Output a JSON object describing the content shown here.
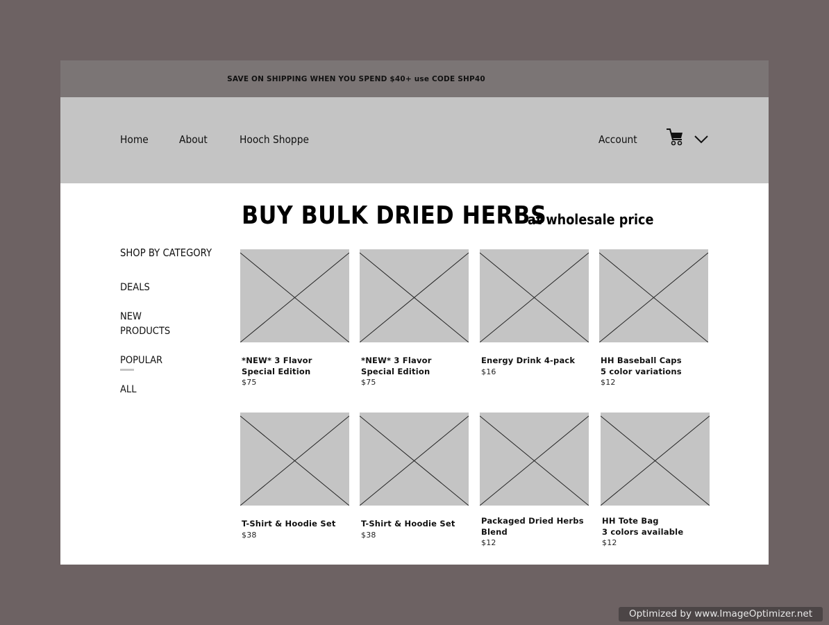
{
  "banner": {
    "text": "SAVE ON SHIPPING WHEN YOU SPEND $40+ use CODE SHP40"
  },
  "nav": {
    "links": [
      "Home",
      "About",
      "Hooch Shoppe"
    ],
    "account": "Account",
    "cart_icon": "cart-icon",
    "dropdown_icon": "chevron-down-icon"
  },
  "heading": {
    "main": "BUY BULK DRIED HERBS",
    "sub": "at wholesale price"
  },
  "sidebar": {
    "title": "SHOP BY CATEGORY",
    "items": [
      "DEALS",
      "NEW PRODUCTS",
      "POPULAR",
      "ALL"
    ],
    "active_item": "POPULAR"
  },
  "products": [
    {
      "name": "*NEW* 3 Flavor Special Edition",
      "price": "$75"
    },
    {
      "name": "*NEW* 3 Flavor Special Edition",
      "price": "$75"
    },
    {
      "name": "Energy Drink  4-pack",
      "price": "$16"
    },
    {
      "name": "HH Baseball Caps\n5 color variations",
      "price": "$12"
    },
    {
      "name": "T-Shirt & Hoodie Set",
      "price": "$38"
    },
    {
      "name": "T-Shirt & Hoodie Set",
      "price": "$38"
    },
    {
      "name": "Packaged Dried Herbs Blend",
      "price": "$12"
    },
    {
      "name": "HH Tote Bag\n3 colors available",
      "price": "$12"
    }
  ],
  "watermark": "Optimized by www.ImageOptimizer.net",
  "colors": {
    "background": "#6d6263",
    "banner": "#7b7575",
    "nav": "#c4c4c4",
    "placeholder": "#c4c4c4"
  }
}
